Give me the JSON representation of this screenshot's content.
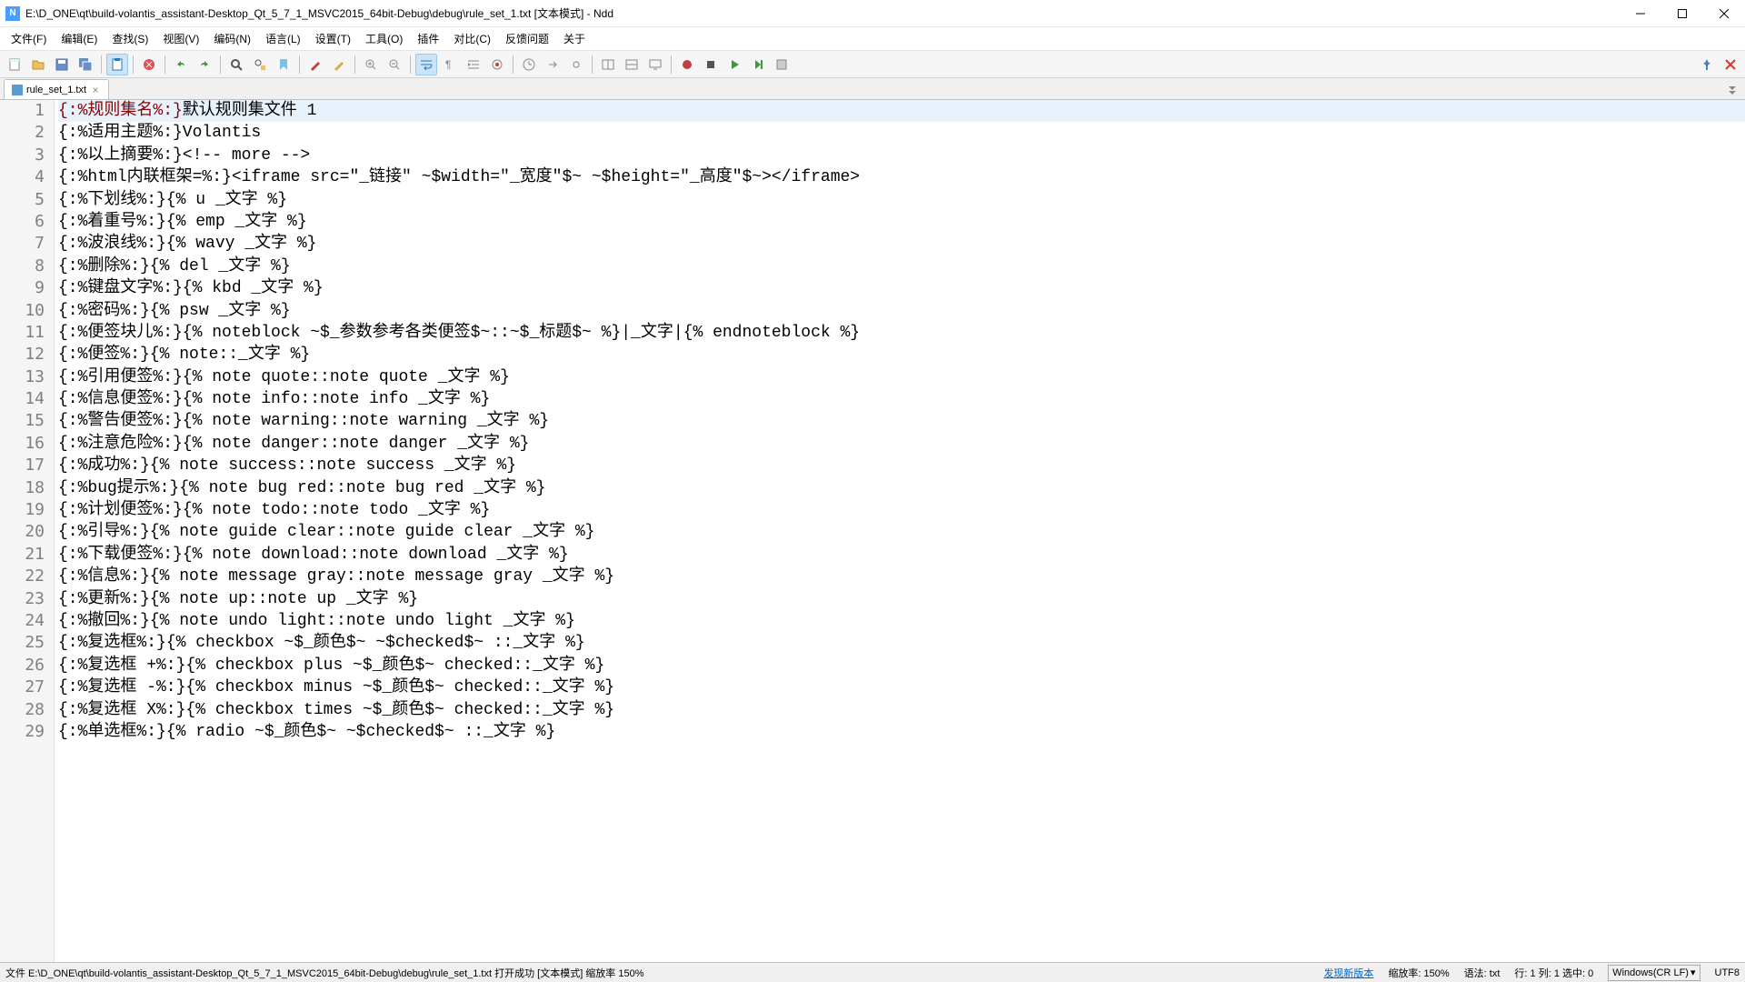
{
  "title": "E:\\D_ONE\\qt\\build-volantis_assistant-Desktop_Qt_5_7_1_MSVC2015_64bit-Debug\\debug\\rule_set_1.txt [文本模式] - Ndd",
  "menu": {
    "file": "文件(F)",
    "edit": "编辑(E)",
    "search": "查找(S)",
    "view": "视图(V)",
    "encoding": "编码(N)",
    "language": "语言(L)",
    "settings": "设置(T)",
    "tools": "工具(O)",
    "plugins": "插件",
    "compare": "对比(C)",
    "feedback": "反馈问题",
    "about": "关于"
  },
  "tab": {
    "label": "rule_set_1.txt"
  },
  "lines": [
    {
      "n": 1,
      "hl": "{:%规则集名%:}",
      "rest": "默认规则集文件 1",
      "current": true
    },
    {
      "n": 2,
      "text": "{:%适用主题%:}Volantis"
    },
    {
      "n": 3,
      "text": "{:%以上摘要%:}<!-- more -->"
    },
    {
      "n": 4,
      "text": "{:%html内联框架=%:}<iframe src=\"_链接\" ~$width=\"_宽度\"$~ ~$height=\"_高度\"$~></iframe>"
    },
    {
      "n": 5,
      "text": "{:%下划线%:}{% u _文字 %}"
    },
    {
      "n": 6,
      "text": "{:%着重号%:}{% emp _文字 %}"
    },
    {
      "n": 7,
      "text": "{:%波浪线%:}{% wavy _文字 %}"
    },
    {
      "n": 8,
      "text": "{:%删除%:}{% del _文字 %}"
    },
    {
      "n": 9,
      "text": "{:%键盘文字%:}{% kbd _文字 %}"
    },
    {
      "n": 10,
      "text": "{:%密码%:}{% psw _文字 %}"
    },
    {
      "n": 11,
      "text": "{:%便签块儿%:}{% noteblock ~$_参数参考各类便签$~::~$_标题$~ %}|_文字|{% endnoteblock %}"
    },
    {
      "n": 12,
      "text": "{:%便签%:}{% note::_文字 %}"
    },
    {
      "n": 13,
      "text": "{:%引用便签%:}{% note quote::note quote _文字 %}"
    },
    {
      "n": 14,
      "text": "{:%信息便签%:}{% note info::note info _文字 %}"
    },
    {
      "n": 15,
      "text": "{:%警告便签%:}{% note warning::note warning _文字 %}"
    },
    {
      "n": 16,
      "text": "{:%注意危险%:}{% note danger::note danger _文字 %}"
    },
    {
      "n": 17,
      "text": "{:%成功%:}{% note success::note success _文字 %}"
    },
    {
      "n": 18,
      "text": "{:%bug提示%:}{% note bug red::note bug red _文字 %}"
    },
    {
      "n": 19,
      "text": "{:%计划便签%:}{% note todo::note todo _文字 %}"
    },
    {
      "n": 20,
      "text": "{:%引导%:}{% note guide clear::note guide clear _文字 %}"
    },
    {
      "n": 21,
      "text": "{:%下载便签%:}{% note download::note download _文字 %}"
    },
    {
      "n": 22,
      "text": "{:%信息%:}{% note message gray::note message gray _文字 %}"
    },
    {
      "n": 23,
      "text": "{:%更新%:}{% note up::note up _文字 %}"
    },
    {
      "n": 24,
      "text": "{:%撤回%:}{% note undo light::note undo light _文字 %}"
    },
    {
      "n": 25,
      "text": "{:%复选框%:}{% checkbox ~$_颜色$~ ~$checked$~ ::_文字 %}"
    },
    {
      "n": 26,
      "text": "{:%复选框 +%:}{% checkbox plus ~$_颜色$~ checked::_文字 %}"
    },
    {
      "n": 27,
      "text": "{:%复选框 -%:}{% checkbox minus ~$_颜色$~ checked::_文字 %}"
    },
    {
      "n": 28,
      "text": "{:%复选框 X%:}{% checkbox times ~$_颜色$~ checked::_文字 %}"
    },
    {
      "n": 29,
      "text": "{:%单选框%:}{% radio ~$_颜色$~ ~$checked$~ ::_文字 %}"
    }
  ],
  "status": {
    "left": "文件 E:\\D_ONE\\qt\\build-volantis_assistant-Desktop_Qt_5_7_1_MSVC2015_64bit-Debug\\debug\\rule_set_1.txt 打开成功 [文本模式] 缩放率 150%",
    "update": "发现新版本",
    "zoom": "缩放率: 150%",
    "lang": "语法: txt",
    "pos": "行: 1 列: 1 选中: 0",
    "eol": "Windows(CR LF)",
    "enc": "UTF8"
  }
}
